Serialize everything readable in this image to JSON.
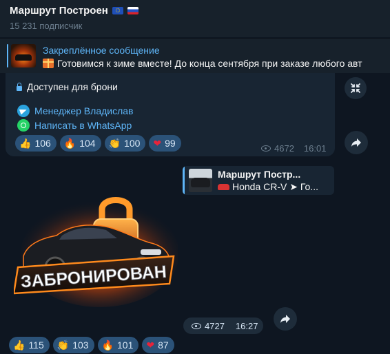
{
  "channel": {
    "title": "Маршрут Построен",
    "flags": [
      "eu-flag",
      "russia-flag"
    ],
    "subscribers": "15 231 подписчик"
  },
  "pinned": {
    "title": "Закреплённое сообщение",
    "text": "Готовимся к зиме вместе!  До конца сентября при заказе любого авт"
  },
  "message1": {
    "lock_text": "Доступен для брони",
    "links": [
      "Менеджер Владислав",
      "Написать в WhatsApp"
    ],
    "reactions": [
      {
        "icon": "thumbs-up-icon",
        "glyph": "👍",
        "count": "106"
      },
      {
        "icon": "fire-icon",
        "glyph": "🔥",
        "count": "104"
      },
      {
        "icon": "clap-icon",
        "glyph": "👏",
        "count": "100"
      },
      {
        "icon": "heart-icon",
        "glyph": "❤",
        "count": "99"
      }
    ],
    "views": "4672",
    "time": "16:01"
  },
  "message2": {
    "reply": {
      "title": "Маршрут Постр...",
      "text": "Honda CR-V   ➤ Го..."
    },
    "sticker_text": "ЗАБРОНИРОВАН",
    "views": "4727",
    "time": "16:27",
    "reactions": [
      {
        "icon": "thumbs-up-icon",
        "glyph": "👍",
        "count": "115"
      },
      {
        "icon": "clap-icon",
        "glyph": "👏",
        "count": "103"
      },
      {
        "icon": "fire-icon",
        "glyph": "🔥",
        "count": "101"
      },
      {
        "icon": "heart-icon",
        "glyph": "❤",
        "count": "87"
      }
    ]
  },
  "colors": {
    "background": "#0e1621",
    "header": "#17212b",
    "bubble": "#182533",
    "accent": "#5eb5f7",
    "reaction_pill": "#2b5278"
  }
}
